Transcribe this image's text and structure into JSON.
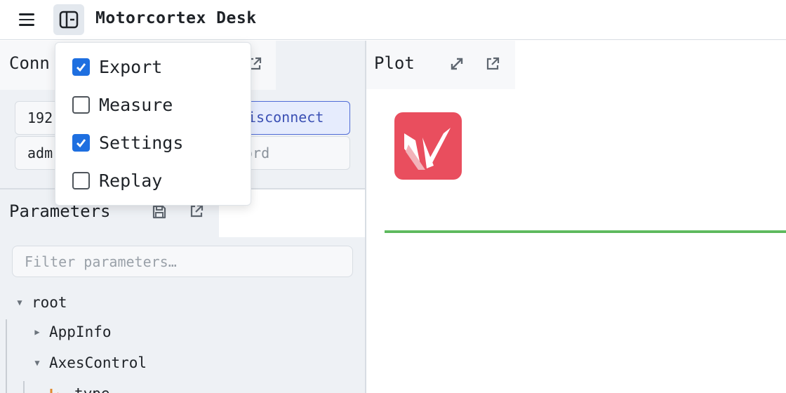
{
  "app": {
    "title": "Motorcortex Desk"
  },
  "icons": {
    "menu": "hamburger-icon",
    "panel_toggle": "sidebar-panel-icon",
    "popout": "external-link-icon",
    "save": "floppy-disk-icon",
    "expand": "expand-arrows-icon",
    "logo": "motorcortex-logo-icon"
  },
  "colors": {
    "accent": "#1e6fe0",
    "logo": "#e94e5e",
    "plot_line": "#5cb85c",
    "disconnect_border": "#4f6bd6"
  },
  "connection": {
    "tab_label": "Conn",
    "host_value": "192",
    "user_value": "adm",
    "disconnect_label": "isconnect",
    "password_placeholder": "ord"
  },
  "dropdown": {
    "items": [
      {
        "label": "Export",
        "checked": true
      },
      {
        "label": "Measure",
        "checked": false
      },
      {
        "label": "Settings",
        "checked": true
      },
      {
        "label": "Replay",
        "checked": false
      }
    ]
  },
  "parameters": {
    "tab_label": "Parameters",
    "filter_placeholder": "Filter parameters…",
    "tree": [
      {
        "label": "root",
        "expanded": true
      },
      {
        "label": "AppInfo",
        "expanded": false
      },
      {
        "label": "AxesControl",
        "expanded": true
      },
      {
        "label": "type"
      }
    ]
  },
  "plot": {
    "tab_label": "Plot"
  }
}
